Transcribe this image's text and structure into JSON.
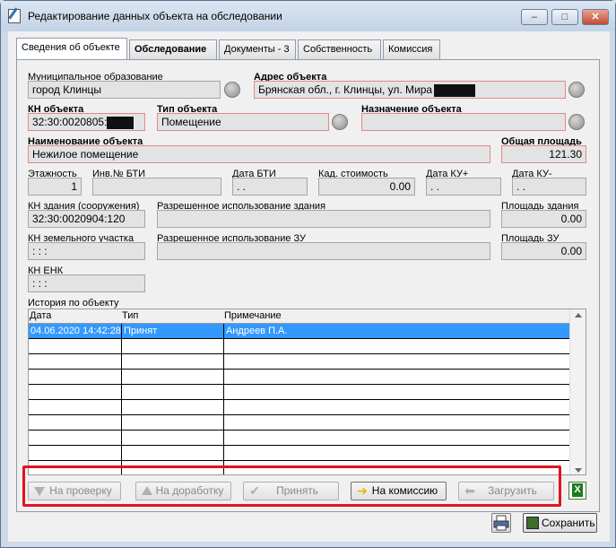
{
  "window": {
    "title": "Редактирование данных объекта на обследовании",
    "minimize": "‒",
    "maximize": "□",
    "close": "✕"
  },
  "tabs": [
    {
      "label": "Сведения об объекте"
    },
    {
      "label": "Обследование"
    },
    {
      "label": "Документы - 3"
    },
    {
      "label": "Собственность"
    },
    {
      "label": "Комиссия"
    }
  ],
  "form": {
    "municipality_label": "Муниципальное образование",
    "municipality_value": "город Клинцы",
    "address_label": "Адрес объекта",
    "address_value": "Брянская обл., г. Клинцы, ул. Мира",
    "kn_label": "КН объекта",
    "kn_value": "32:30:0020805:",
    "type_label": "Тип объекта",
    "type_value": "Помещение",
    "purpose_label": "Назначение объекта",
    "purpose_value": "",
    "name_label": "Наименование объекта",
    "name_value": "Нежилое помещение",
    "area_label": "Общая площадь",
    "area_value": "121.30",
    "floors_label": "Этажность",
    "floors_value": "1",
    "inv_label": "Инв.№ БТИ",
    "inv_value": "",
    "bti_date_label": "Дата БТИ",
    "bti_date_value": " . .",
    "cad_cost_label": "Кад. стоимость",
    "cad_cost_value": "0.00",
    "ku_plus_label": "Дата КУ+",
    "ku_plus_value": " . .",
    "ku_minus_label": "Дата КУ-",
    "ku_minus_value": " . .",
    "kn_building_label": "КН здания (сооружения)",
    "kn_building_value": "32:30:0020904:120",
    "building_use_label": "Разрешенное использование здания",
    "building_use_value": "",
    "building_area_label": "Площадь здания",
    "building_area_value": "0.00",
    "kn_land_label": "КН земельного участка",
    "kn_land_value": " :  :      :",
    "land_use_label": "Разрешенное использование ЗУ",
    "land_use_value": "",
    "land_area_label": "Площадь ЗУ",
    "land_area_value": "0.00",
    "enk_label": "КН ЕНК",
    "enk_value": " :  :      :"
  },
  "history": {
    "label": "История по объекту",
    "columns": [
      "Дата",
      "Тип",
      "Примечание"
    ],
    "rows": [
      {
        "date": "04.06.2020 14:42:28",
        "type": "Принят",
        "note": "Андреев П.А."
      }
    ]
  },
  "actions": {
    "check": "На проверку",
    "rework": "На доработку",
    "accept": "Принять",
    "commission": "На комиссию",
    "load": "Загрузить"
  },
  "footer": {
    "save": "Сохранить"
  },
  "colors": {
    "highlight": "#e3131e",
    "selection": "#3399ff"
  }
}
